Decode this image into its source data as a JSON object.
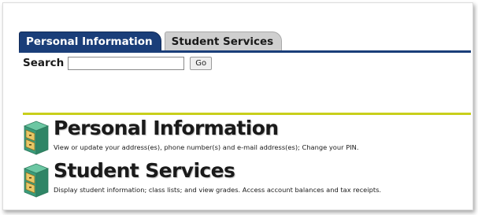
{
  "tabs": [
    {
      "label": "Personal Information",
      "active": true
    },
    {
      "label": "Student Services",
      "active": false
    }
  ],
  "search": {
    "label": "Search",
    "value": "",
    "placeholder": "",
    "button_label": "Go"
  },
  "menu": [
    {
      "title": "Personal Information",
      "description": "View or update your address(es), phone number(s) and e-mail address(es); Change your PIN.",
      "icon": "file-cabinet-icon"
    },
    {
      "title": "Student Services",
      "description": "Display student information; class lists; and view grades. Access account balances and tax receipts.",
      "icon": "file-cabinet-icon"
    }
  ],
  "colors": {
    "tab_active": "#1a3e79",
    "tab_inactive": "#cfcfcf",
    "divider": "#c8cf1b",
    "icon_green": "#3a9b7a",
    "icon_drawer": "#e8c766"
  }
}
